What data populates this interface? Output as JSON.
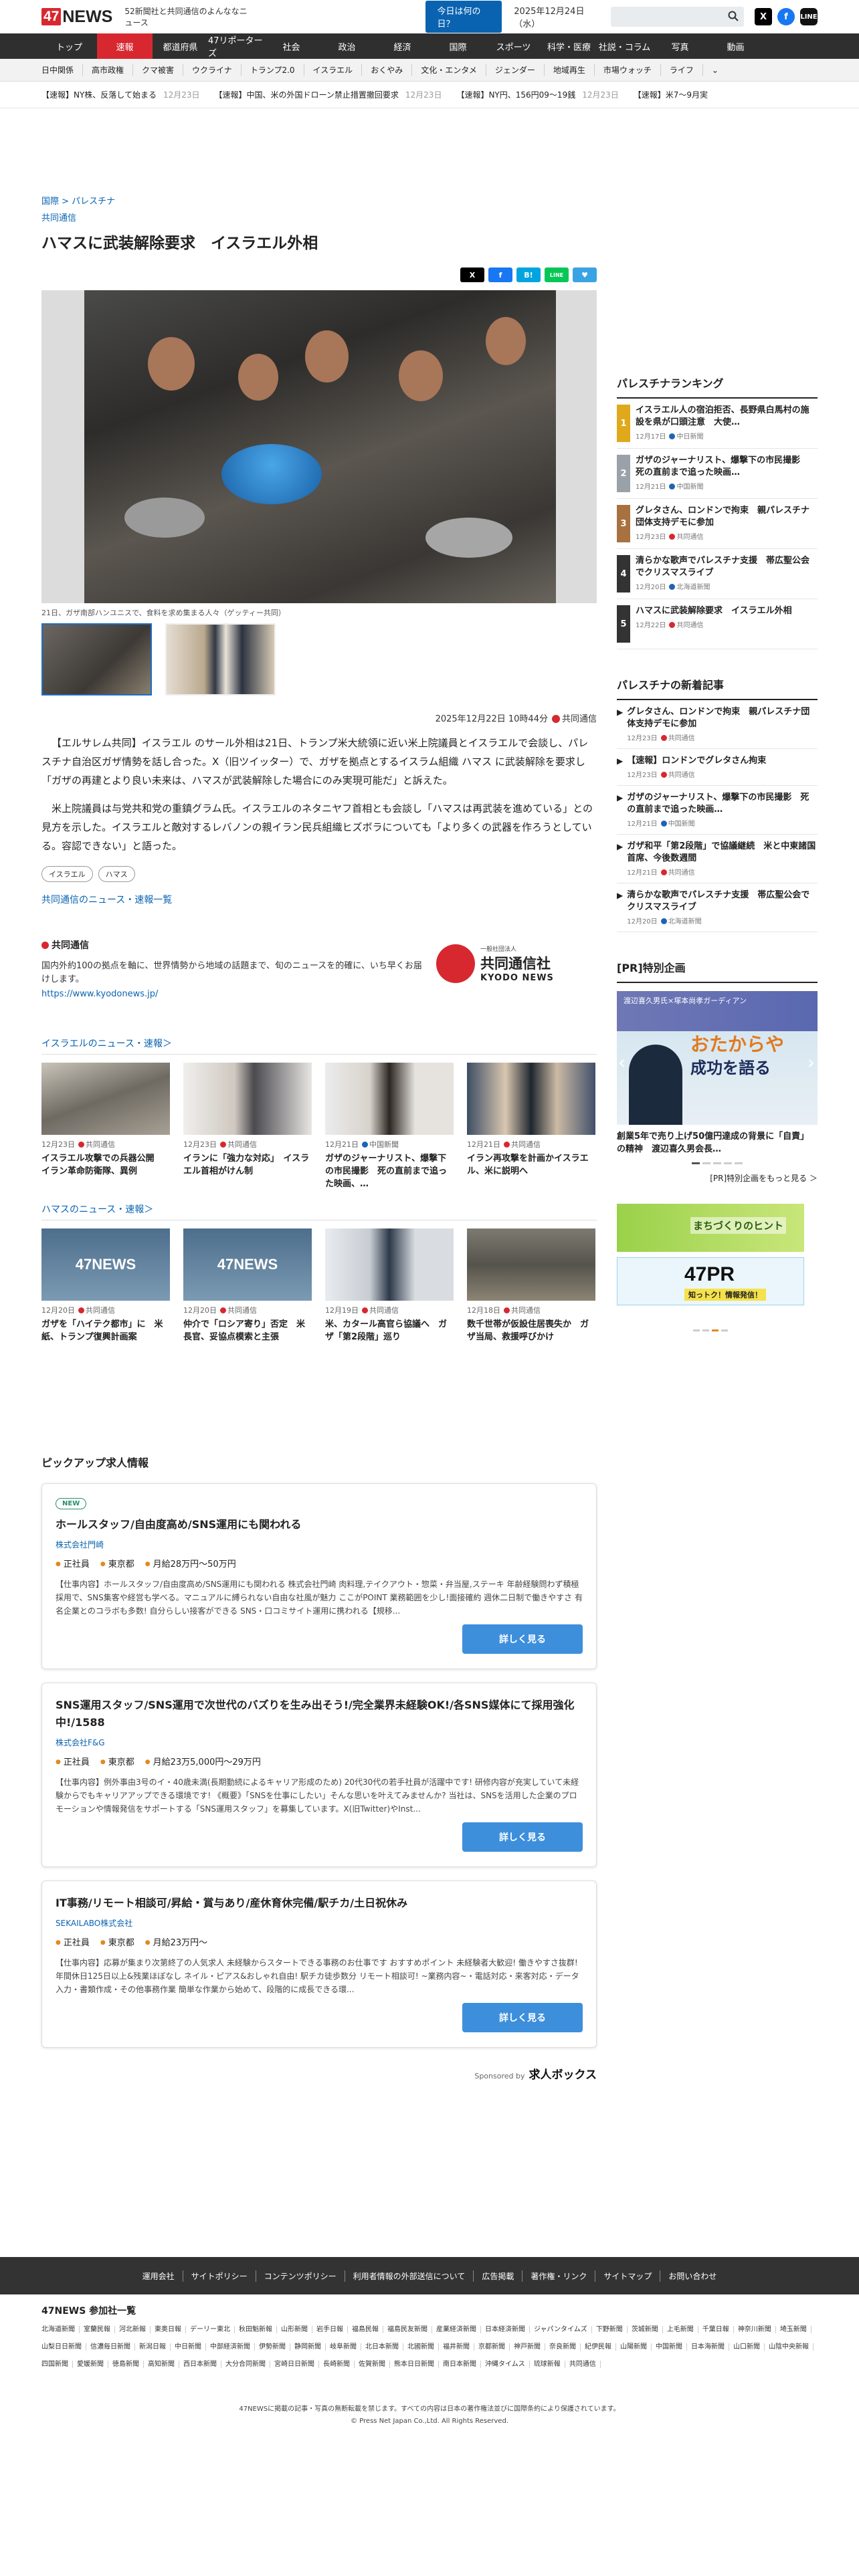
{
  "header": {
    "logo_num": "47",
    "logo_text": "NEWS",
    "tagline": "52新聞社と共同通信のよんななニュース",
    "today_button": "今日は何の日？",
    "date": "2025年12月24日（水）"
  },
  "nav_main": [
    "トップ",
    "速報",
    "都道府県",
    "47リポーターズ",
    "社会",
    "政治",
    "経済",
    "国際",
    "スポーツ",
    "科学・医療",
    "社説・コラム",
    "写真",
    "動画"
  ],
  "nav_sub": [
    "日中関係",
    "高市政権",
    "クマ被害",
    "ウクライナ",
    "トランプ2.0",
    "イスラエル",
    "おくやみ",
    "文化・エンタメ",
    "ジェンダー",
    "地域再生",
    "市場ウォッチ",
    "ライフ"
  ],
  "ticker": [
    {
      "text": "【速報】NY株、反落して始まる",
      "date": "12月23日"
    },
    {
      "text": "【速報】中国、米の外国ドローン禁止措置撤回要求",
      "date": "12月23日"
    },
    {
      "text": "【速報】NY円、156円09〜19銭",
      "date": "12月23日"
    },
    {
      "text": "【速報】米7〜9月実",
      "date": ""
    }
  ],
  "article": {
    "breadcrumb": "国際 > パレスチナ",
    "source": "共同通信",
    "title": "ハマスに武装解除要求　イスラエル外相",
    "share": [
      "X",
      "f",
      "B!",
      "LINE",
      "♥"
    ],
    "caption": "21日、ガザ南部ハンユニスで、食料を求め集まる人々（ゲッティー共同）",
    "date": "2025年12月22日 10時44分",
    "provider": "共同通信",
    "paragraphs": [
      "【エルサレム共同】イスラエル のサール外相は21日、トランプ米大統領に近い米上院議員とイスラエルで会談し、パレスチナ自治区ガザ情勢を話し合った。X（旧ツイッター）で、ガザを拠点とするイスラム組織 ハマス に武装解除を要求し「ガザの再建とより良い未来は、ハマスが武装解除した場合にのみ実現可能だ」と訴えた。",
      "米上院議員は与党共和党の重鎮グラム氏。イスラエルのネタニヤフ首相とも会談し「ハマスは再武装を進めている」との見方を示した。イスラエルと敵対するレバノンの親イラン民兵組織ヒズボラについても「より多くの武器を作ろうとしている。容認できない」と語った。"
    ],
    "tags": [
      "イスラエル",
      "ハマス"
    ],
    "more_link": "共同通信のニュース・速報一覧"
  },
  "provider_box": {
    "title": "共同通信",
    "desc": "国内外約100の拠点を軸に、世界情勢から地域の話題まで、旬のニュースを的確に、いち早くお届けします。",
    "url": "https://www.kyodonews.jp/",
    "logo_small": "一般社団法人",
    "logo_jp": "共同通信社",
    "logo_en": "KYODO NEWS"
  },
  "israel_section": {
    "title": "イスラエルのニュース・速報＞",
    "cards": [
      {
        "date": "12月23日",
        "source": "共同通信",
        "title": "イスラエル攻撃での兵器公開　イラン革命防衛隊、異例"
      },
      {
        "date": "12月23日",
        "source": "共同通信",
        "title": "イランに「強力な対応」　イスラエル首相がけん制"
      },
      {
        "date": "12月21日",
        "source": "中国新聞",
        "title": "ガザのジャーナリスト、爆撃下の市民撮影　死の直前まで追った映画、…"
      },
      {
        "date": "12月21日",
        "source": "共同通信",
        "title": "イラン再攻撃を計画かイスラエル、米に説明へ"
      }
    ]
  },
  "hamas_section": {
    "title": "ハマスのニュース・速報＞",
    "cards": [
      {
        "date": "12月20日",
        "source": "共同通信",
        "title": "ガザを「ハイテク都市」に　米紙、トランプ復興計画案"
      },
      {
        "date": "12月20日",
        "source": "共同通信",
        "title": "仲介で「ロシア寄り」否定　米長官、妥協点模索と主張"
      },
      {
        "date": "12月19日",
        "source": "共同通信",
        "title": "米、カタール高官ら協議へ　ガザ「第2段階」巡り"
      },
      {
        "date": "12月18日",
        "source": "共同通信",
        "title": "数千世帯が仮設住居喪失か　ガザ当局、救援呼びかけ"
      }
    ]
  },
  "jobs": {
    "title": "ピックアップ求人情報",
    "items": [
      {
        "badge": "NEW",
        "title": "ホールスタッフ/自由度高め/SNS運用にも関われる",
        "company": "株式会社門崎",
        "type": "正社員",
        "location": "東京都",
        "salary": "月給28万円〜50万円",
        "desc": "【仕事内容】ホールスタッフ/自由度高め/SNS運用にも関われる 株式会社門崎 肉料理,テイクアウト・惣菜・弁当屋,ステーキ 年齢経験問わず積極採用で、SNS集客や経営も学べる。マニュアルに縛られない自由な社風が魅力 ここがPOINT 業務範囲を少し!面接確約 週休二日制で働きやすさ 有名企業とのコラボも多数! 自分らしい接客ができる SNS・口コミサイト運用に携われる【規移...",
        "button": "詳しく見る"
      },
      {
        "badge": "",
        "title": "SNS運用スタッフ/SNS運用で次世代のバズりを生み出そう!/完全業界未経験OK!/各SNS媒体にて採用強化中!/1588",
        "company": "株式会社F&G",
        "type": "正社員",
        "location": "東京都",
        "salary": "月給23万5,000円〜29万円",
        "desc": "【仕事内容】例外事由3号のイ・40歳未満(長期勤続によるキャリア形成のため) 20代30代の若手社員が活躍中です! 研修内容が充実していて未経験からでもキャリアアップできる環境です! 《概要》「SNSを仕事にしたい」そんな思いを叶えてみませんか? 当社は、SNSを活用した企業のプロモーションや情報発信をサポートする「SNS運用スタッフ」を募集しています。X(旧Twitter)やInst...",
        "button": "詳しく見る"
      },
      {
        "badge": "",
        "title": "IT事務/リモート相談可/昇給・賞与あり/産休育休完備/駅チカ/土日祝休み",
        "company": "SEKAILABO株式会社",
        "type": "正社員",
        "location": "東京都",
        "salary": "月給23万円〜",
        "desc": "【仕事内容】応募が集まり次第終了の人気求人 未経験からスタートできる事務のお仕事です おすすめポイント 未経験者大歓迎! 働きやすさ抜群! 年間休日125日以上&残業ほぼなし ネイル・ピアス&おしゃれ自由! 駅チカ徒歩数分 リモート相談可! ~業務内容~・電話対応・来客対応・データ入力・書類作成・その他事務作業 簡単な作業から始めて、段階的に成長できる環...",
        "button": "詳しく見る"
      }
    ],
    "sponsored_label": "Sponsored by",
    "sponsor": "求人ボックス"
  },
  "sidebar": {
    "ranking_title": "パレスチナランキング",
    "ranking": [
      {
        "rank": "1",
        "title": "イスラエル人の宿泊拒否、長野県白馬村の施設を県が口頭注意　大使…",
        "date": "12月17日",
        "source": "中日新聞"
      },
      {
        "rank": "2",
        "title": "ガザのジャーナリスト、爆撃下の市民撮影　死の直前まで追った映画…",
        "date": "12月21日",
        "source": "中国新聞"
      },
      {
        "rank": "3",
        "title": "グレタさん、ロンドンで拘束　親パレスチナ団体支持デモに参加",
        "date": "12月23日",
        "source": "共同通信"
      },
      {
        "rank": "4",
        "title": "清らかな歌声でパレスチナ支援　帯広聖公会でクリスマスライブ",
        "date": "12月20日",
        "source": "北海道新聞"
      },
      {
        "rank": "5",
        "title": "ハマスに武装解除要求　イスラエル外相",
        "date": "12月22日",
        "source": "共同通信"
      }
    ],
    "latest_title": "パレスチナの新着記事",
    "latest": [
      {
        "title": "グレタさん、ロンドンで拘束　親パレスチナ団体支持デモに参加",
        "date": "12月23日",
        "source": "共同通信"
      },
      {
        "title": "【速報】ロンドンでグレタさん拘束",
        "date": "12月23日",
        "source": "共同通信"
      },
      {
        "title": "ガザのジャーナリスト、爆撃下の市民撮影　死の直前まで追った映画…",
        "date": "12月21日",
        "source": "中国新聞"
      },
      {
        "title": "ガザ和平「第2段階」で協議継続　米と中東諸国首席、今後数週間",
        "date": "12月21日",
        "source": "共同通信"
      },
      {
        "title": "清らかな歌声でパレスチナ支援　帯広聖公会でクリスマスライブ",
        "date": "12月20日",
        "source": "北海道新聞"
      }
    ],
    "pr_title": "[PR]特別企画",
    "pr_head": "渡辺喜久男氏×塚本尚孝ガーディアン",
    "pr_big1": "おたからや",
    "pr_big2": "成功を語る",
    "pr_headline": "創業5年で売り上げ50億円達成の背景に「自責」の精神　渡辺喜久男会長…",
    "pr_all": "[PR]特別企画をもっと見る ＞",
    "ad1_text": "まちづくりのヒント",
    "ad2_text": "47PR",
    "ad2_sub": "知っトク！情報発信！"
  },
  "footer": {
    "links": [
      "運用会社",
      "サイトポリシー",
      "コンテンツポリシー",
      "利用者情報の外部送信について",
      "広告掲載",
      "著作権・リンク",
      "サイトマップ",
      "お問い合わせ"
    ],
    "partners_title": "47NEWS 参加社一覧",
    "partners": [
      "北海道新聞",
      "室蘭民報",
      "河北新報",
      "東奥日報",
      "デーリー東北",
      "秋田魁新報",
      "山形新聞",
      "岩手日報",
      "福島民報",
      "福島民友新聞",
      "産業経済新聞",
      "日本経済新聞",
      "ジャパンタイムズ",
      "下野新聞",
      "茨城新聞",
      "上毛新聞",
      "千葉日報",
      "神奈川新聞",
      "埼玉新聞",
      "山梨日日新聞",
      "信濃毎日新聞",
      "新潟日報",
      "中日新聞",
      "中部経済新聞",
      "伊勢新聞",
      "静岡新聞",
      "岐阜新聞",
      "北日本新聞",
      "北國新聞",
      "福井新聞",
      "京都新聞",
      "神戸新聞",
      "奈良新聞",
      "紀伊民報",
      "山陽新聞",
      "中国新聞",
      "日本海新聞",
      "山口新聞",
      "山陰中央新報",
      "四国新聞",
      "愛媛新聞",
      "徳島新聞",
      "高知新聞",
      "西日本新聞",
      "大分合同新聞",
      "宮崎日日新聞",
      "長崎新聞",
      "佐賀新聞",
      "熊本日日新聞",
      "南日本新聞",
      "沖縄タイムス",
      "琉球新報",
      "共同通信"
    ],
    "copy1": "47NEWSに掲載の記事・写真の無断転載を禁じます。すべての内容は日本の著作権法並びに国際条約により保護されています。",
    "copy2": "© Press Net Japan Co.,Ltd. All Rights Reserved."
  }
}
